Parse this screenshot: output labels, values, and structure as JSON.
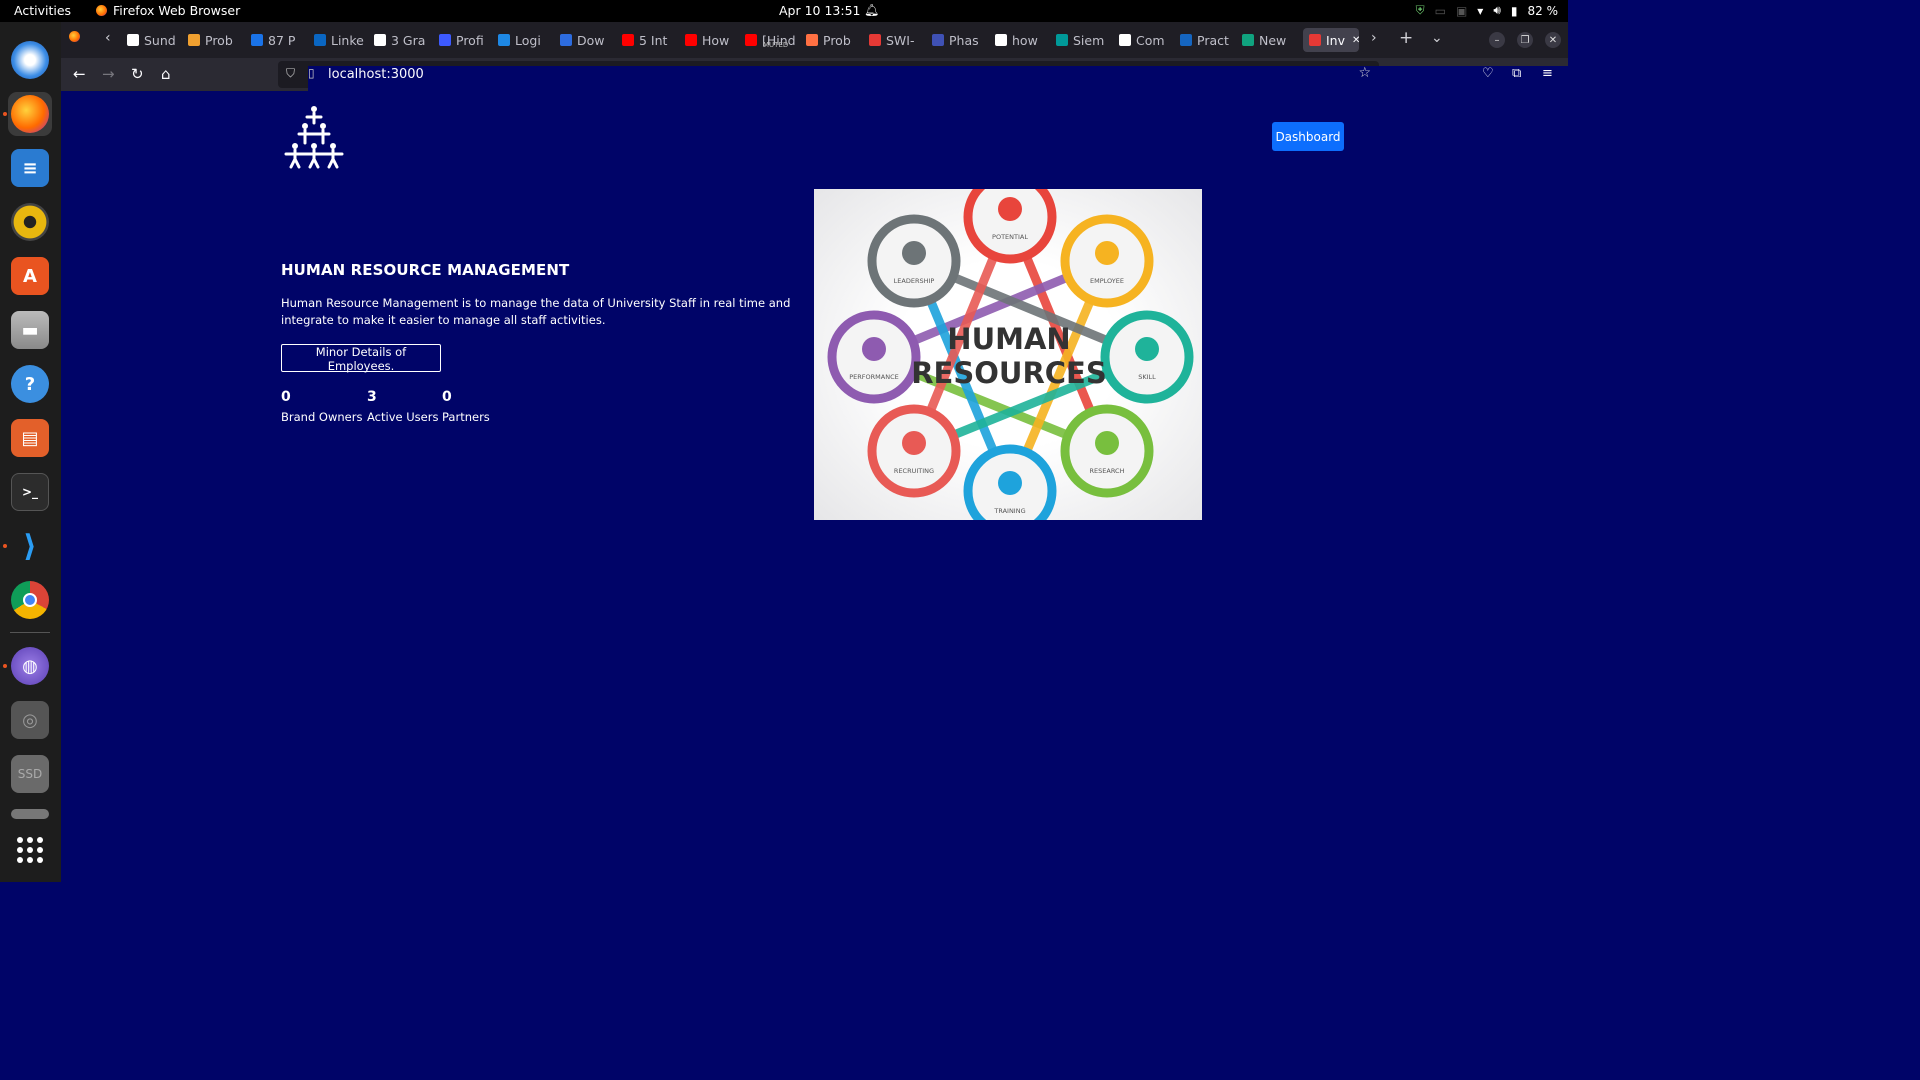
{
  "system": {
    "activities": "Activities",
    "app_name": "Firefox Web Browser",
    "clock": "Apr 10  13:51",
    "battery": "82 %"
  },
  "tabs": [
    {
      "label": "Sund",
      "color": "#ffffff"
    },
    {
      "label": "Prob",
      "color": "#f0a030"
    },
    {
      "label": "87 P",
      "color": "#1a73e8"
    },
    {
      "label": "Linke",
      "color": "#0a66c2"
    },
    {
      "label": "3 Gra",
      "color": "#ffffff"
    },
    {
      "label": "Profi",
      "color": "#3d5afe"
    },
    {
      "label": "Logi",
      "color": "#1e88e5"
    },
    {
      "label": "Dow",
      "color": "#2d6cdf"
    },
    {
      "label": "5 Int",
      "color": "#ff0000"
    },
    {
      "label": "How",
      "color": "#ff0000"
    },
    {
      "label": "[Hind",
      "color": "#ff0000"
    },
    {
      "label": "Prob",
      "color": "#ff7043"
    },
    {
      "label": "SWI-",
      "color": "#e53935"
    },
    {
      "label": "Phas",
      "color": "#3f51b5"
    },
    {
      "label": "how",
      "color": "#ffffff"
    },
    {
      "label": "Siem",
      "color": "#009999"
    },
    {
      "label": "Com",
      "color": "#ffffff"
    },
    {
      "label": "Pract",
      "color": "#1565c0"
    },
    {
      "label": "New",
      "color": "#10a37f"
    },
    {
      "label": "Inv",
      "color": "#e53935"
    }
  ],
  "tab_muted_badge": "MUTED",
  "url": "localhost:3000",
  "header": {
    "dashboard_label": "Dashboard"
  },
  "hero": {
    "title": "HUMAN RESOURCE MANAGEMENT",
    "description": "Human Resource Management is to manage the data of University Staff in real time and integrate to make it easier to manage all staff activities.",
    "button_label": "Minor Details of Employees."
  },
  "stats": [
    {
      "value": "0",
      "label": "Brand Owners"
    },
    {
      "value": "3",
      "label": "Active Users"
    },
    {
      "value": "0",
      "label": "Partners"
    }
  ],
  "illustration": {
    "title_line1": "HUMAN",
    "title_line2": "RESOURCES",
    "nodes": [
      {
        "label": "POTENTIAL",
        "color": "#e8453c"
      },
      {
        "label": "EMPLOYEE",
        "color": "#f6b321"
      },
      {
        "label": "SKILL",
        "color": "#1fb39a"
      },
      {
        "label": "RESEARCH",
        "color": "#78bf3e"
      },
      {
        "label": "TRAINING",
        "color": "#1ea3dc"
      },
      {
        "label": "RECRUITING",
        "color": "#e85a55"
      },
      {
        "label": "PERFORMANCE",
        "color": "#8e5bb0"
      },
      {
        "label": "LEADERSHIP",
        "color": "#6d7477"
      }
    ]
  },
  "colors": {
    "page_bg": "#000468",
    "primary_button": "#0d6efd"
  }
}
